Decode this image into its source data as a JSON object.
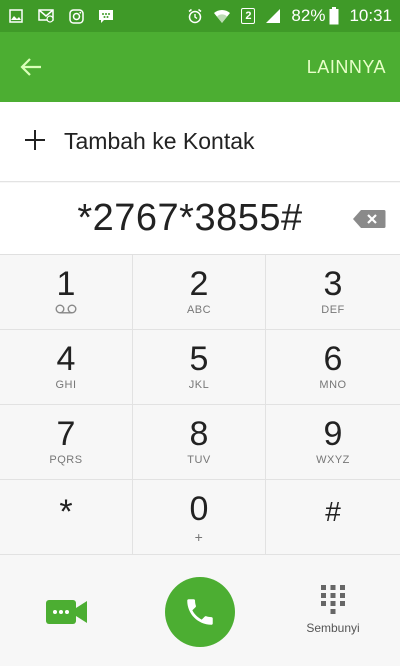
{
  "status_bar": {
    "battery_percent": "82%",
    "time": "10:31",
    "sim_slot": "2",
    "icons_left": [
      "gallery-icon",
      "message-icon",
      "instagram-icon",
      "bbm-icon"
    ],
    "icons_right": [
      "alarm-icon",
      "wifi-icon",
      "sim-icon",
      "signal-icon",
      "battery-icon"
    ]
  },
  "app_bar": {
    "back_icon": "arrow-left-icon",
    "more_label": "LAINNYA"
  },
  "add_contact": {
    "label": "Tambah ke Kontak",
    "icon": "plus-icon"
  },
  "dial_number": "*2767*3855#",
  "keys": [
    {
      "digit": "1",
      "sub": "",
      "sub_icon": "voicemail-icon"
    },
    {
      "digit": "2",
      "sub": "ABC"
    },
    {
      "digit": "3",
      "sub": "DEF"
    },
    {
      "digit": "4",
      "sub": "GHI"
    },
    {
      "digit": "5",
      "sub": "JKL"
    },
    {
      "digit": "6",
      "sub": "MNO"
    },
    {
      "digit": "7",
      "sub": "PQRS"
    },
    {
      "digit": "8",
      "sub": "TUV"
    },
    {
      "digit": "9",
      "sub": "WXYZ"
    },
    {
      "digit": "*",
      "sub": ""
    },
    {
      "digit": "0",
      "sub": "+"
    },
    {
      "digit": "#",
      "sub": ""
    }
  ],
  "actions": {
    "video_icon": "video-call-icon",
    "call_icon": "phone-icon",
    "hide_label": "Sembunyi",
    "hide_icon": "dialpad-icon"
  },
  "colors": {
    "status_bar": "#3f9a28",
    "app_bar": "#4cae32",
    "accent": "#4cae32",
    "more_text": "#e8ffc9"
  }
}
